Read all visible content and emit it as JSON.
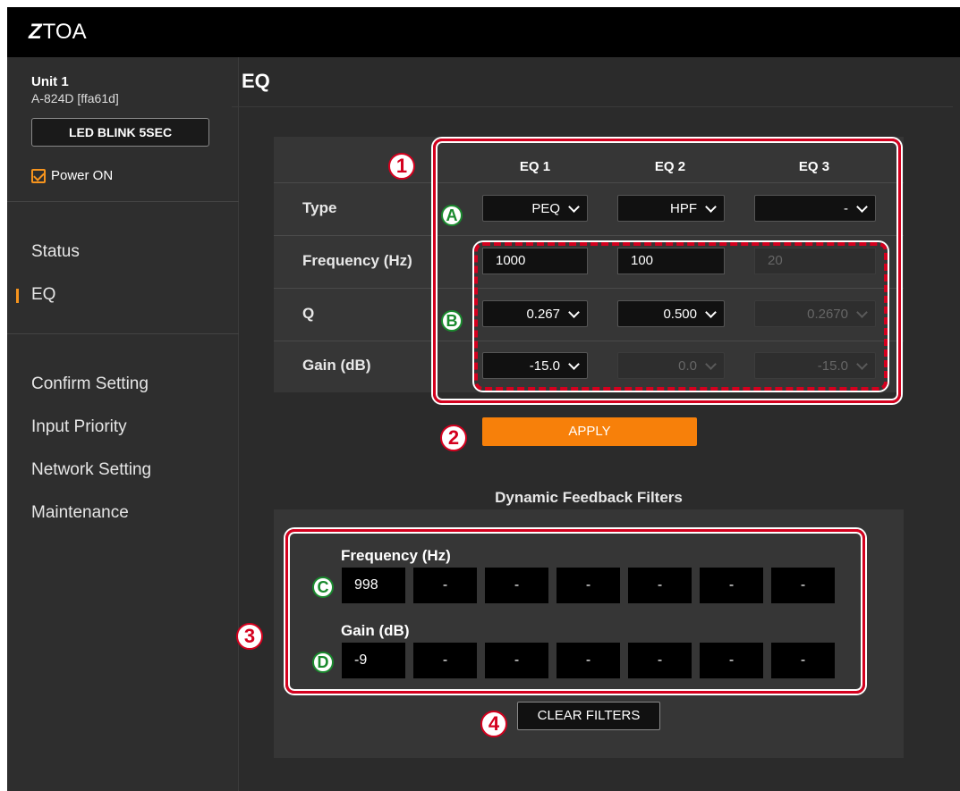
{
  "brand": {
    "logo_mark": "Z",
    "logo_text": "TOA"
  },
  "sidebar": {
    "unit_name": "Unit 1",
    "unit_model": "A-824D [ffa61d]",
    "blink_button": "LED BLINK 5SEC",
    "power_label": "Power ON",
    "power_checked": true,
    "nav_primary": [
      {
        "label": "Status",
        "active": false
      },
      {
        "label": "EQ",
        "active": true
      }
    ],
    "nav_secondary": [
      {
        "label": "Confirm Setting"
      },
      {
        "label": "Input Priority"
      },
      {
        "label": "Network Setting"
      },
      {
        "label": "Maintenance"
      }
    ]
  },
  "main": {
    "title": "EQ",
    "eq_table": {
      "columns": [
        "EQ 1",
        "EQ 2",
        "EQ 3"
      ],
      "rows": {
        "type": {
          "label": "Type",
          "values": [
            "PEQ",
            "HPF",
            "-"
          ]
        },
        "frequency": {
          "label": "Frequency (Hz)",
          "values": [
            "1000",
            "100",
            "20"
          ]
        },
        "q": {
          "label": "Q",
          "values": [
            "0.267",
            "0.500",
            "0.2670"
          ]
        },
        "gain": {
          "label": "Gain (dB)",
          "values": [
            "-15.0",
            "0.0",
            "-15.0"
          ]
        }
      }
    },
    "apply_button": "APPLY",
    "dff": {
      "title": "Dynamic Feedback Filters",
      "frequency_label": "Frequency (Hz)",
      "frequency_values": [
        "998",
        "-",
        "-",
        "-",
        "-",
        "-",
        "-"
      ],
      "gain_label": "Gain (dB)",
      "gain_values": [
        "-9",
        "-",
        "-",
        "-",
        "-",
        "-",
        "-"
      ]
    },
    "clear_button": "CLEAR FILTERS"
  },
  "callouts": {
    "numbers": [
      "1",
      "2",
      "3",
      "4"
    ],
    "letters": [
      "A",
      "B",
      "C",
      "D"
    ]
  },
  "colors": {
    "accent": "#f7941d",
    "apply": "#f7800a",
    "callout_red": "#d4001e",
    "callout_green": "#1a8a2e"
  }
}
